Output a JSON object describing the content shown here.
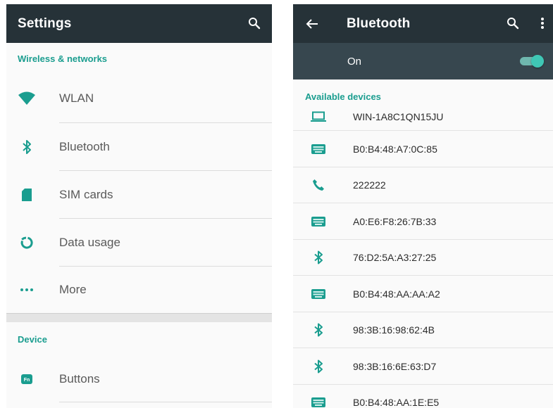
{
  "colors": {
    "appbar": "#263238",
    "switch_bar": "#37474f",
    "accent": "#1a9d8f",
    "toggle_thumb": "#3fc7b5"
  },
  "settings": {
    "title": "Settings",
    "header_icon": "search-icon",
    "sections": [
      {
        "header": "Wireless & networks",
        "items": [
          {
            "label": "WLAN",
            "icon": "wifi-icon"
          },
          {
            "label": "Bluetooth",
            "icon": "bluetooth-icon"
          },
          {
            "label": "SIM cards",
            "icon": "sim-card-icon"
          },
          {
            "label": "Data usage",
            "icon": "data-usage-icon"
          },
          {
            "label": "More",
            "icon": "more-icon"
          }
        ]
      },
      {
        "header": "Device",
        "items": [
          {
            "label": "Buttons",
            "icon": "fn-key-icon"
          }
        ]
      }
    ]
  },
  "bluetooth": {
    "title": "Bluetooth",
    "header_icons": [
      "back-arrow-icon",
      "search-icon",
      "overflow-menu-icon"
    ],
    "switch_label": "On",
    "switch_on": true,
    "section_header": "Available devices",
    "devices": [
      {
        "name": "WIN-1A8C1QN15JU",
        "icon": "laptop-icon"
      },
      {
        "name": "B0:B4:48:A7:0C:85",
        "icon": "keyboard-icon"
      },
      {
        "name": "222222",
        "icon": "phone-icon"
      },
      {
        "name": "A0:E6:F8:26:7B:33",
        "icon": "keyboard-icon"
      },
      {
        "name": "76:D2:5A:A3:27:25",
        "icon": "bluetooth-icon"
      },
      {
        "name": "B0:B4:48:AA:AA:A2",
        "icon": "keyboard-icon"
      },
      {
        "name": "98:3B:16:98:62:4B",
        "icon": "bluetooth-icon"
      },
      {
        "name": "98:3B:16:6E:63:D7",
        "icon": "bluetooth-icon"
      },
      {
        "name": "B0:B4:48:AA:1E:E5",
        "icon": "keyboard-icon"
      }
    ]
  }
}
